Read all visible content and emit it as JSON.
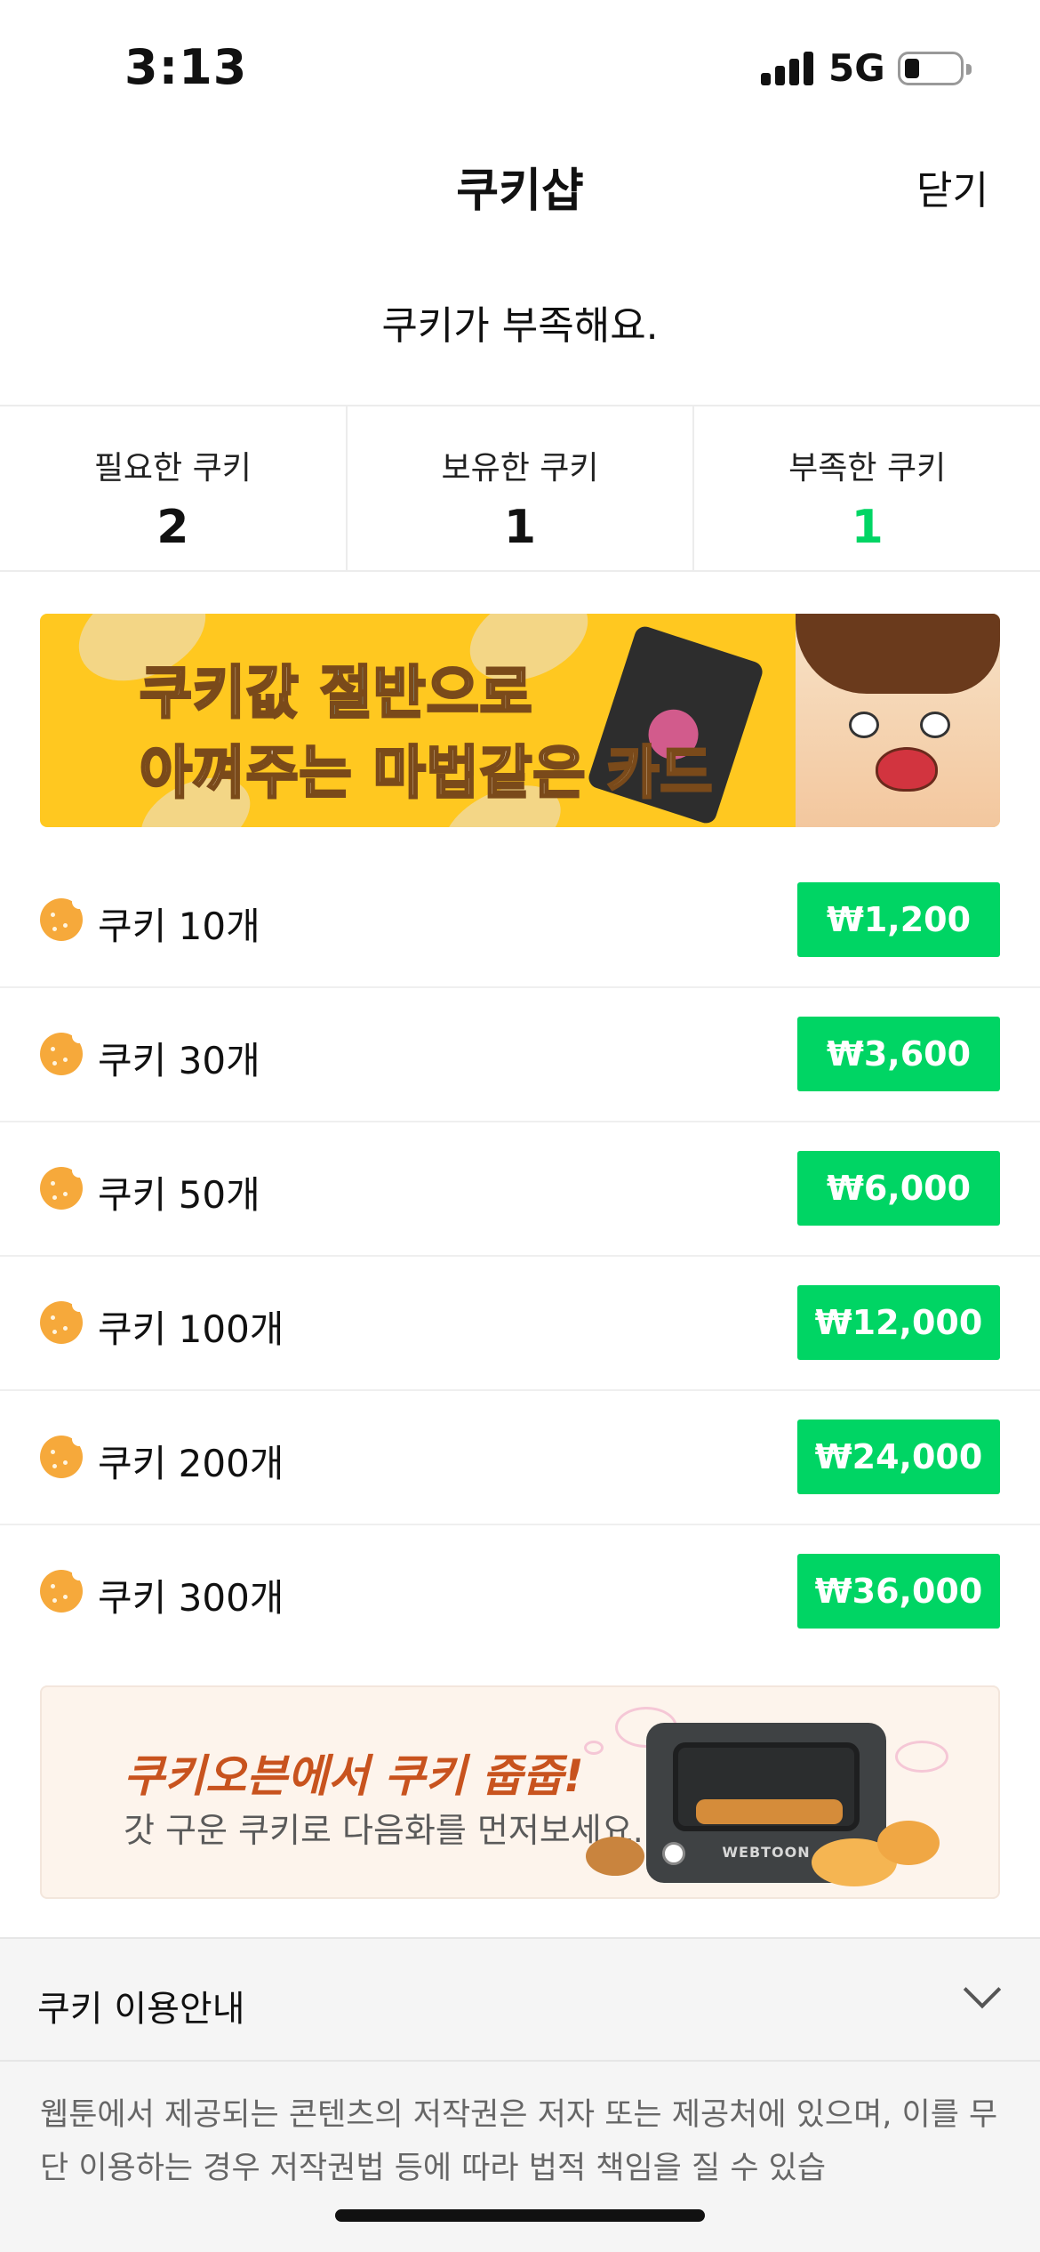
{
  "status_bar": {
    "time": "3:13",
    "network": "5G"
  },
  "header": {
    "title": "쿠키샵",
    "close_label": "닫기"
  },
  "notice": "쿠키가 부족해요.",
  "stats": [
    {
      "label": "필요한 쿠키",
      "value": "2"
    },
    {
      "label": "보유한 쿠키",
      "value": "1"
    },
    {
      "label": "부족한 쿠키",
      "value": "1"
    }
  ],
  "promo_banner": {
    "line1_pre": "쿠키값 ",
    "line1_highlight": "절반",
    "line1_post": "으로",
    "line2": "아껴주는 마법같은 카드"
  },
  "cookie_items": [
    {
      "label": "쿠키 10개",
      "price": "₩1,200"
    },
    {
      "label": "쿠키 30개",
      "price": "₩3,600"
    },
    {
      "label": "쿠키 50개",
      "price": "₩6,000"
    },
    {
      "label": "쿠키 100개",
      "price": "₩12,000"
    },
    {
      "label": "쿠키 200개",
      "price": "₩24,000"
    },
    {
      "label": "쿠키 300개",
      "price": "₩36,000"
    }
  ],
  "oven_banner": {
    "title": "쿠키오븐에서 쿠키 줍줍!",
    "subtitle": "갓 구운 쿠키로 다음화를 먼저보세요.",
    "brand": "WEBTOON"
  },
  "usage_guide": {
    "title": "쿠키 이용안내",
    "text": "웹툰에서 제공되는 콘텐츠의 저작권은 저자 또는 제공처에 있으며, 이를 무단 이용하는 경우 저작권법 등에 따라 법적 책임을 질 수 있습"
  },
  "colors": {
    "accent_green": "#00d564",
    "banner_yellow": "#ffc820",
    "cookie_orange": "#f6a93b"
  }
}
